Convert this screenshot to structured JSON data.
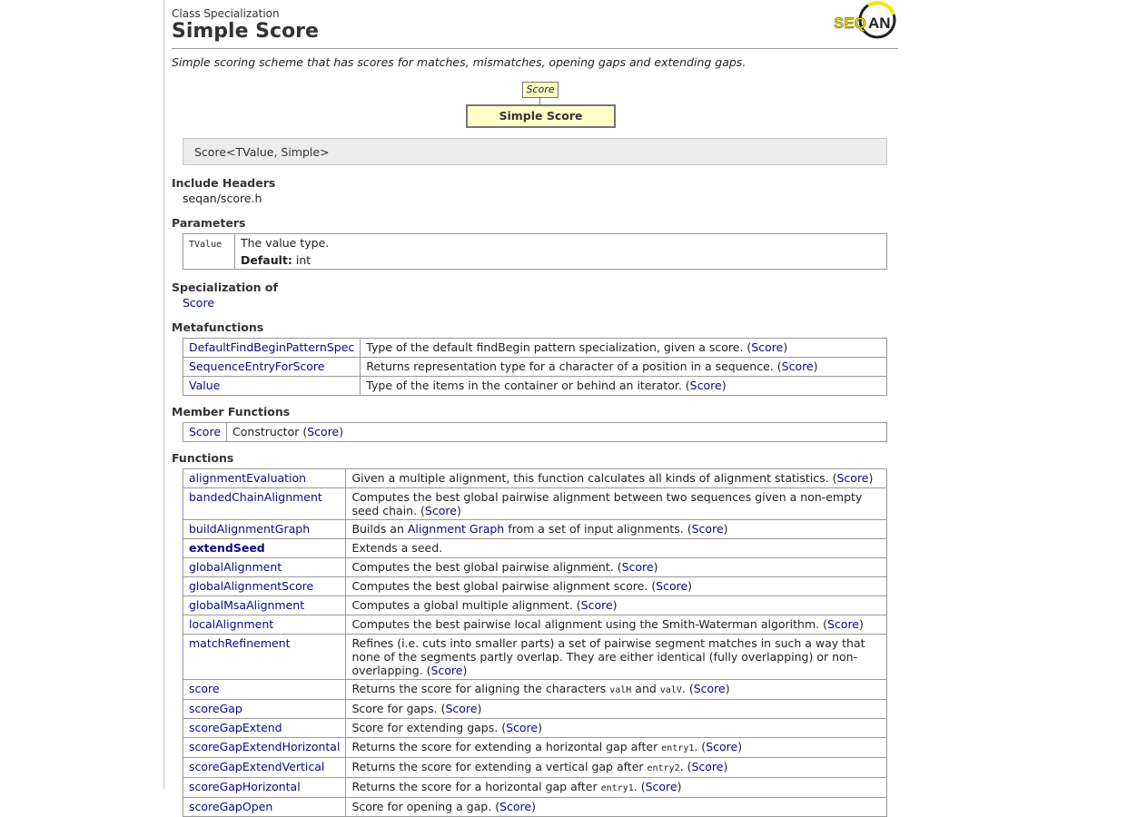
{
  "header": {
    "kind": "Class Specialization",
    "title": "Simple Score",
    "logo_text": "SEQAN"
  },
  "summary": "Simple scoring scheme that has scores for matches, mismatches, opening gaps and extending gaps.",
  "diagram": {
    "parent": "Score",
    "self": "Simple Score"
  },
  "signature": "Score<TValue, Simple>",
  "include": {
    "heading": "Include Headers",
    "value": "seqan/score.h"
  },
  "parameters": {
    "heading": "Parameters",
    "name": "TValue",
    "desc": "The value type.",
    "default_label": "Default:",
    "default_value": "int"
  },
  "specialization_of": {
    "heading": "Specialization of",
    "link": "Score"
  },
  "metafunctions": {
    "heading": "Metafunctions",
    "rows": [
      {
        "name": "DefaultFindBeginPatternSpec",
        "desc": "Type of the default findBegin pattern specialization, given a score. (",
        "ref": "Score",
        "close": ")"
      },
      {
        "name": "SequenceEntryForScore",
        "desc": "Returns representation type for a character of a position in a sequence. (",
        "ref": "Score",
        "close": ")"
      },
      {
        "name": "Value",
        "desc": "Type of the items in the container or behind an iterator. (",
        "ref": "Score",
        "close": ")"
      }
    ]
  },
  "member_functions": {
    "heading": "Member Functions",
    "rows": [
      {
        "name": "Score",
        "desc": "Constructor (",
        "ref": "Score",
        "close": ")"
      }
    ]
  },
  "functions": {
    "heading": "Functions",
    "rows": [
      {
        "name": "alignmentEvaluation",
        "desc": "Given a multiple alignment, this function calculates all kinds of alignment statistics. (",
        "ref": "Score",
        "close": ")"
      },
      {
        "name": "bandedChainAlignment",
        "desc": "Computes the best global pairwise alignment between two sequences given a non-empty seed chain. (",
        "ref": "Score",
        "close": ")"
      },
      {
        "name": "buildAlignmentGraph",
        "desc_pre": "Builds an ",
        "link": "Alignment Graph",
        "desc": " from a set of input alignments. (",
        "ref": "Score",
        "close": ")"
      },
      {
        "name": "extendSeed",
        "desc": "Extends a seed.",
        "ref": "",
        "close": ""
      },
      {
        "name": "globalAlignment",
        "desc": "Computes the best global pairwise alignment. (",
        "ref": "Score",
        "close": ")"
      },
      {
        "name": "globalAlignmentScore",
        "desc": "Computes the best global pairwise alignment score. (",
        "ref": "Score",
        "close": ")"
      },
      {
        "name": "globalMsaAlignment",
        "desc": "Computes a global multiple alignment. (",
        "ref": "Score",
        "close": ")"
      },
      {
        "name": "localAlignment",
        "desc": "Computes the best pairwise local alignment using the Smith-Waterman algorithm. (",
        "ref": "Score",
        "close": ")"
      },
      {
        "name": "matchRefinement",
        "desc": "Refines (i.e. cuts into smaller parts) a set of pairwise segment matches in such a way that none of the segments partly overlap. They are either identical (fully overlapping) or non-overlapping. (",
        "ref": "Score",
        "close": ")"
      },
      {
        "name": "score",
        "desc_pre": "Returns the score for aligning the characters ",
        "code1": "valH",
        "mid": " and ",
        "code2": "valV",
        "desc": ". (",
        "ref": "Score",
        "close": ")"
      },
      {
        "name": "scoreGap",
        "desc": "Score for gaps. (",
        "ref": "Score",
        "close": ")"
      },
      {
        "name": "scoreGapExtend",
        "desc": "Score for extending gaps. (",
        "ref": "Score",
        "close": ")"
      },
      {
        "name": "scoreGapExtendHorizontal",
        "desc_pre": "Returns the score for extending a horizontal gap after ",
        "code1": "entry1",
        "desc": ". (",
        "ref": "Score",
        "close": ")"
      },
      {
        "name": "scoreGapExtendVertical",
        "desc_pre": "Returns the score for extending a vertical gap after ",
        "code1": "entry2",
        "desc": ". (",
        "ref": "Score",
        "close": ")"
      },
      {
        "name": "scoreGapHorizontal",
        "desc_pre": "Returns the score for a horizontal gap after ",
        "code1": "entry1",
        "desc": ". (",
        "ref": "Score",
        "close": ")"
      },
      {
        "name": "scoreGapOpen",
        "desc": "Score for opening a gap. (",
        "ref": "Score",
        "close": ")"
      }
    ]
  }
}
